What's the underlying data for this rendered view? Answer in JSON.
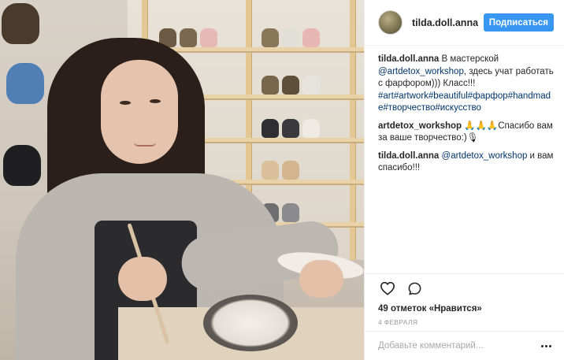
{
  "post": {
    "image_alt": "photo"
  },
  "header": {
    "username": "tilda.doll.anna",
    "follow_label": "Подписаться"
  },
  "comments": [
    {
      "user": "tilda.doll.anna",
      "parts": [
        {
          "t": "text",
          "v": " В мастерской "
        },
        {
          "t": "link",
          "v": "@artdetox_workshop"
        },
        {
          "t": "text",
          "v": ", здесь учат работать с фарфором))) Класс!!! "
        },
        {
          "t": "link",
          "v": "#art#artwork#beautiful#фарфор#handmade#творчество#искусство"
        }
      ]
    },
    {
      "user": "artdetox_workshop",
      "parts": [
        {
          "t": "text",
          "v": " 🙏🙏🙏Спасибо вам за ваше творчество:)🎙"
        }
      ]
    },
    {
      "user": "tilda.doll.anna",
      "parts": [
        {
          "t": "text",
          "v": " "
        },
        {
          "t": "link",
          "v": "@artdetox_workshop"
        },
        {
          "t": "text",
          "v": " и вам спасибо!!!"
        }
      ]
    }
  ],
  "actions": {
    "like_icon": "heart-icon",
    "comment_icon": "comment-icon",
    "likes_text": "49 отметок «Нравится»",
    "date": "4 ФЕВРАЛЯ"
  },
  "add_comment": {
    "placeholder": "Добавьте комментарий...",
    "more_icon": "more-icon"
  },
  "colors": {
    "accent": "#3897f0",
    "link": "#003569",
    "text": "#262626",
    "muted": "#999999"
  }
}
